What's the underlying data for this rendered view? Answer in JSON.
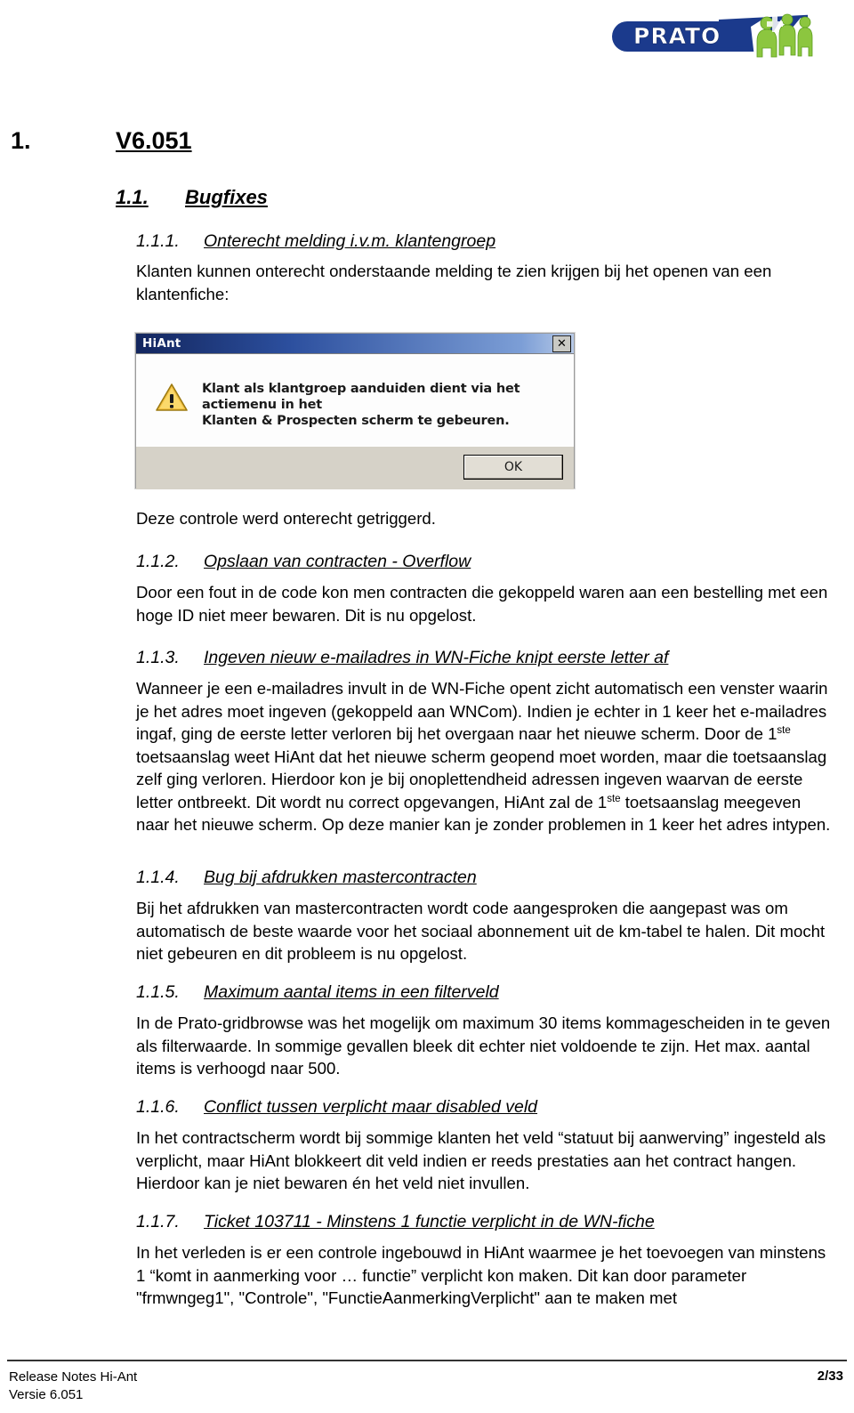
{
  "logo": {
    "name": "prato-logo",
    "text": "PRATO",
    "pill_color": "#1b3a8c",
    "figure_color": "#8cc63f"
  },
  "headings": {
    "h1_number": "1.",
    "h1_title": "V6.051",
    "h2_number": "1.1.",
    "h2_title": "Bugfixes"
  },
  "sections": [
    {
      "number": "1.1.1.",
      "title": "Onterecht melding i.v.m. klantengroep",
      "body": "Klanten kunnen onterecht onderstaande melding te zien krijgen bij het openen van een klantenfiche:",
      "body_after": "Deze controle werd onterecht getriggerd."
    },
    {
      "number": "1.1.2.",
      "title": "Opslaan van contracten - Overflow",
      "body": "Door een fout in de code kon men contracten die gekoppeld waren aan een bestelling met een hoge ID niet meer bewaren. Dit is nu opgelost."
    },
    {
      "number": "1.1.3.",
      "title": "Ingeven nieuw e-mailadres in WN-Fiche knipt eerste letter af",
      "body_part1": "Wanneer je een e-mailadres invult in de WN-Fiche opent zicht automatisch een venster waarin je het adres moet ingeven (gekoppeld aan WNCom). Indien je echter in 1 keer het e-mailadres ingaf, ging de eerste letter verloren bij het overgaan naar het nieuwe scherm. Door de 1",
      "sup1": "ste",
      "body_part2": " toetsaanslag weet HiAnt dat het nieuwe scherm geopend moet worden, maar die toetsaanslag zelf ging verloren. Hierdoor kon je bij onoplettendheid adressen ingeven waarvan de eerste letter ontbreekt. Dit wordt nu correct opgevangen, HiAnt zal de 1",
      "sup2": "ste",
      "body_part3": " toetsaanslag meegeven naar het nieuwe scherm. Op deze manier kan je zonder problemen in 1 keer het adres intypen."
    },
    {
      "number": "1.1.4.",
      "title": "Bug bij afdrukken mastercontracten",
      "body": "Bij het afdrukken van mastercontracten wordt code aangesproken die aangepast was om automatisch de beste waarde voor het sociaal abonnement uit de km-tabel te halen. Dit mocht niet gebeuren en dit probleem is nu opgelost."
    },
    {
      "number": "1.1.5.",
      "title": "Maximum aantal items in een filterveld",
      "body": "In de Prato-gridbrowse was het mogelijk om maximum 30 items kommagescheiden in te geven als filterwaarde. In sommige gevallen bleek dit echter niet voldoende te zijn. Het max. aantal items is verhoogd naar 500."
    },
    {
      "number": "1.1.6.",
      "title": "Conflict tussen verplicht maar disabled veld",
      "body": "In het contractscherm wordt bij sommige klanten het veld “statuut bij aanwerving” ingesteld als verplicht, maar HiAnt blokkeert dit veld indien er reeds prestaties aan het contract hangen. Hierdoor kan je niet bewaren én het veld niet invullen."
    },
    {
      "number": "1.1.7.",
      "title": "Ticket 103711 - Minstens 1 functie verplicht in de WN-fiche",
      "body": "In het verleden is er een controle ingebouwd in HiAnt waarmee je het toevoegen van minstens 1 “komt in aanmerking voor … functie” verplicht kon maken. Dit kan door parameter \"frmwngeg1\", \"Controle\", \"FunctieAanmerkingVerplicht\" aan te maken met"
    }
  ],
  "dialog": {
    "title": "HiAnt",
    "close_label": "✕",
    "message_line1": "Klant als klantgroep aanduiden dient via het actiemenu in het",
    "message_line2": "Klanten & Prospecten scherm te gebeuren.",
    "ok_label": "OK",
    "titlebar_color": "#13265e",
    "warning_color": "#f5c242"
  },
  "footer": {
    "line1": "Release Notes Hi-Ant",
    "line2": "Versie 6.051",
    "page": "2/33"
  }
}
